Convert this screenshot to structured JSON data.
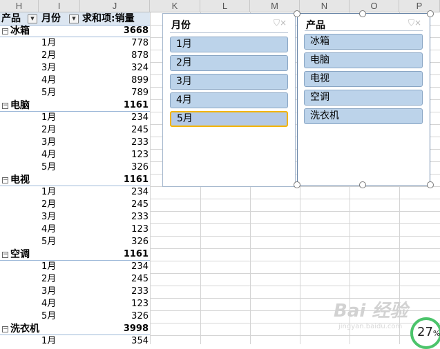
{
  "columns": [
    "H",
    "I",
    "J",
    "K",
    "L",
    "M",
    "N",
    "O",
    "P"
  ],
  "pivot": {
    "headers": {
      "product": "产品",
      "month": "月份",
      "sum": "求和项:销量"
    },
    "groups": [
      {
        "name": "冰箱",
        "total": "3668",
        "rows": [
          {
            "month": "1月",
            "value": "778"
          },
          {
            "month": "2月",
            "value": "878"
          },
          {
            "month": "3月",
            "value": "324"
          },
          {
            "month": "4月",
            "value": "899"
          },
          {
            "month": "5月",
            "value": "789"
          }
        ]
      },
      {
        "name": "电脑",
        "total": "1161",
        "rows": [
          {
            "month": "1月",
            "value": "234"
          },
          {
            "month": "2月",
            "value": "245"
          },
          {
            "month": "3月",
            "value": "233"
          },
          {
            "month": "4月",
            "value": "123"
          },
          {
            "month": "5月",
            "value": "326"
          }
        ]
      },
      {
        "name": "电视",
        "total": "1161",
        "rows": [
          {
            "month": "1月",
            "value": "234"
          },
          {
            "month": "2月",
            "value": "245"
          },
          {
            "month": "3月",
            "value": "233"
          },
          {
            "month": "4月",
            "value": "123"
          },
          {
            "month": "5月",
            "value": "326"
          }
        ]
      },
      {
        "name": "空调",
        "total": "1161",
        "rows": [
          {
            "month": "1月",
            "value": "234"
          },
          {
            "month": "2月",
            "value": "245"
          },
          {
            "month": "3月",
            "value": "233"
          },
          {
            "month": "4月",
            "value": "123"
          },
          {
            "month": "5月",
            "value": "326"
          }
        ]
      },
      {
        "name": "洗衣机",
        "total": "3998",
        "rows": [
          {
            "month": "1月",
            "value": "354"
          }
        ]
      }
    ]
  },
  "slicer_month": {
    "title": "月份",
    "icon": "filter-clear-icon",
    "items": [
      "1月",
      "2月",
      "3月",
      "4月",
      "5月"
    ],
    "selected_index": 4
  },
  "slicer_product": {
    "title": "产品",
    "icon": "filter-clear-icon",
    "items": [
      "冰箱",
      "电脑",
      "电视",
      "空调",
      "洗衣机"
    ]
  },
  "zoom": {
    "value": "27",
    "unit": "%"
  },
  "watermark": {
    "logo": "Bai 经验",
    "url": "jingyan.baidu.com"
  },
  "colors": {
    "pivot_header": "#dce6f1",
    "slicer_item": "#bcd3ea",
    "selected_border": "#f4b400",
    "zoom_ring": "#4cc46b"
  }
}
